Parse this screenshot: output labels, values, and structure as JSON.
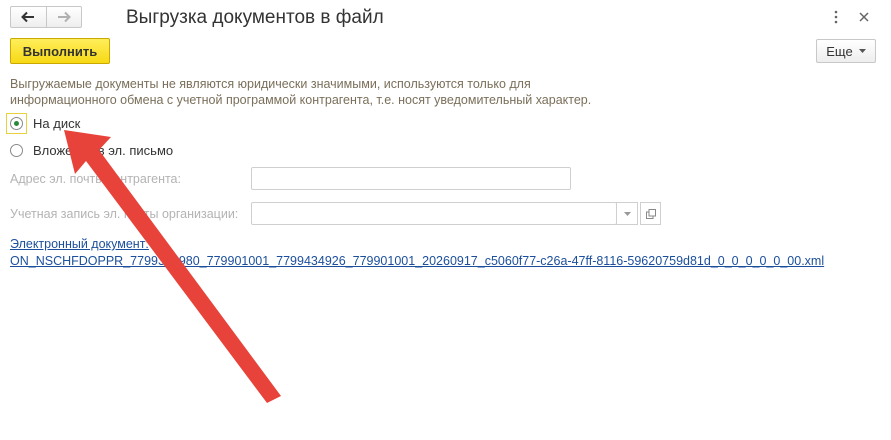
{
  "window": {
    "title": "Выгрузка документов в файл",
    "nav_back_icon": "arrow-left-icon",
    "nav_forward_icon": "arrow-right-icon",
    "menu_icon": "vertical-dots-icon",
    "close_icon": "close-icon"
  },
  "toolbar": {
    "run_label": "Выполнить",
    "more_label": "Еще",
    "more_icon": "dropdown-caret-icon"
  },
  "info_text": {
    "line1": "Выгружаемые документы не являются юридически значимыми, используются только для",
    "line2": "информационного обмена с учетной программой контрагента, т.е. носят уведомительный характер."
  },
  "options": {
    "to_disk": {
      "label": "На диск",
      "selected": true
    },
    "email_attachment": {
      "label": "Вложение в эл. письмо",
      "selected": false
    }
  },
  "fields": {
    "counterparty_email": {
      "label": "Адрес эл. почты контрагента:",
      "value": ""
    },
    "org_email_account": {
      "label": "Учетная запись эл. почты организации:",
      "value": ""
    }
  },
  "document": {
    "label": "Электронный документ:",
    "filename": "ON_NSCHFDOPPR_7799393980_779901001_7799434926_779901001_20260917_c5060f77-c26a-47ff-8116-59620759d81d_0_0_0_0_0_00.xml"
  },
  "annotation": {
    "arrow_color": "#e8433a"
  },
  "colors": {
    "run_button": "#f7d916",
    "link": "#1b4f9c",
    "info_text": "#7a6f5a",
    "radio_checked": "#2a8a3a"
  }
}
